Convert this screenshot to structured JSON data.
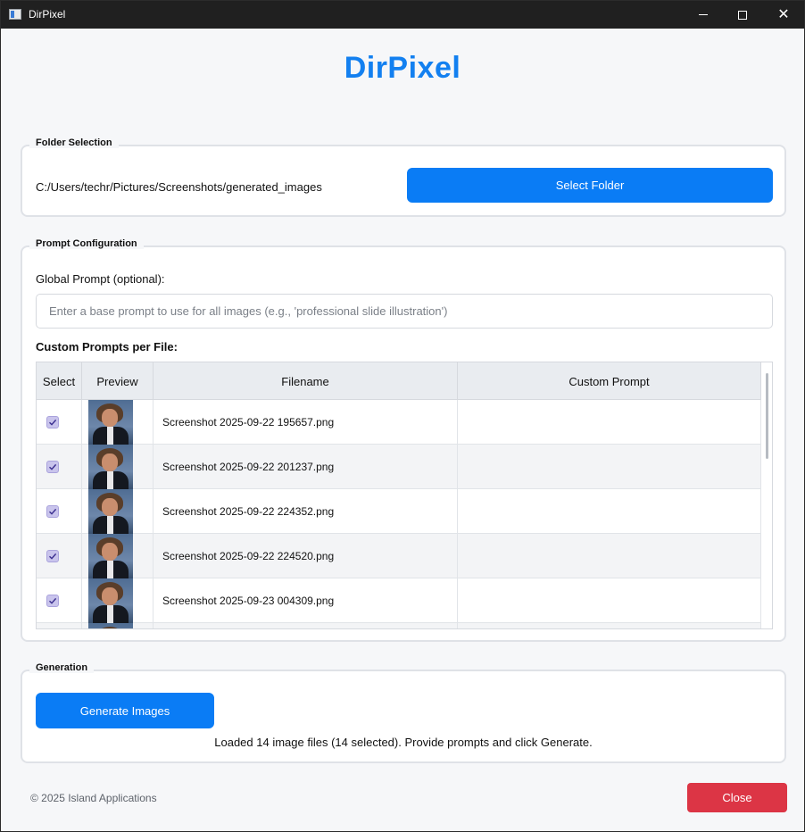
{
  "window": {
    "title": "DirPixel"
  },
  "app_title": "DirPixel",
  "folder_selection": {
    "legend": "Folder Selection",
    "path": "C:/Users/techr/Pictures/Screenshots/generated_images",
    "button_label": "Select Folder"
  },
  "prompt_config": {
    "legend": "Prompt Configuration",
    "global_label": "Global Prompt (optional):",
    "global_value": "",
    "global_placeholder": "Enter a base prompt to use for all images (e.g., 'professional slide illustration')",
    "custom_label": "Custom Prompts per File:",
    "table": {
      "headers": {
        "select": "Select",
        "preview": "Preview",
        "filename": "Filename",
        "custom_prompt": "Custom Prompt"
      },
      "rows": [
        {
          "selected": true,
          "filename": "Screenshot 2025-09-22 195657.png",
          "custom_prompt": ""
        },
        {
          "selected": true,
          "filename": "Screenshot 2025-09-22 201237.png",
          "custom_prompt": ""
        },
        {
          "selected": true,
          "filename": "Screenshot 2025-09-22 224352.png",
          "custom_prompt": ""
        },
        {
          "selected": true,
          "filename": "Screenshot 2025-09-22 224520.png",
          "custom_prompt": ""
        },
        {
          "selected": true,
          "filename": "Screenshot 2025-09-23 004309.png",
          "custom_prompt": ""
        }
      ]
    }
  },
  "generation": {
    "legend": "Generation",
    "button_label": "Generate Images",
    "status": "Loaded 14 image files (14 selected). Provide prompts and click Generate."
  },
  "footer": {
    "copyright": "© 2025 Island Applications",
    "close_label": "Close"
  },
  "colors": {
    "accent": "#0a7cf5",
    "title": "#1380f0",
    "danger": "#dc3545"
  }
}
